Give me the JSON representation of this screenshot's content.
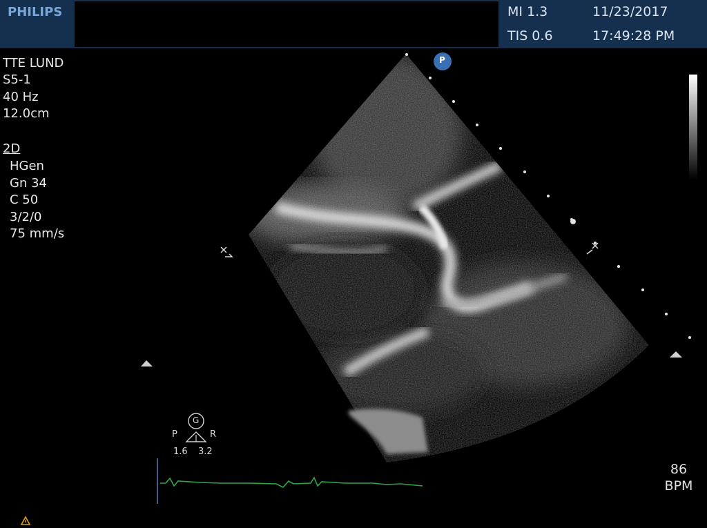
{
  "header": {
    "brand": "PHILIPS",
    "mi": "MI 1.3",
    "tis": "TIS 0.6",
    "date": "11/23/2017",
    "time": "17:49:28 PM"
  },
  "settings": {
    "exam": "TTE LUND",
    "probe": "S5-1",
    "frame_rate": "40 Hz",
    "depth": "12.0cm",
    "mode": "2D",
    "harmonics": "HGen",
    "gain": "Gn 34",
    "compression": "C 50",
    "processing": "3/2/0",
    "sweep_speed": "75 mm/s"
  },
  "markers": {
    "orientation": "P",
    "focus_label": "G",
    "left_label": "P",
    "right_label": "R",
    "left_value": "1.6",
    "right_value": "3.2"
  },
  "heart_rate": {
    "value": "86",
    "unit": "BPM"
  },
  "colors": {
    "header_bg": "#15304f",
    "brand": "#7aa6d6",
    "ecg_trace": "#2fa84a",
    "orientation_marker": "#3b6fb3"
  },
  "icons": {
    "warning": "warning-triangle-icon"
  }
}
